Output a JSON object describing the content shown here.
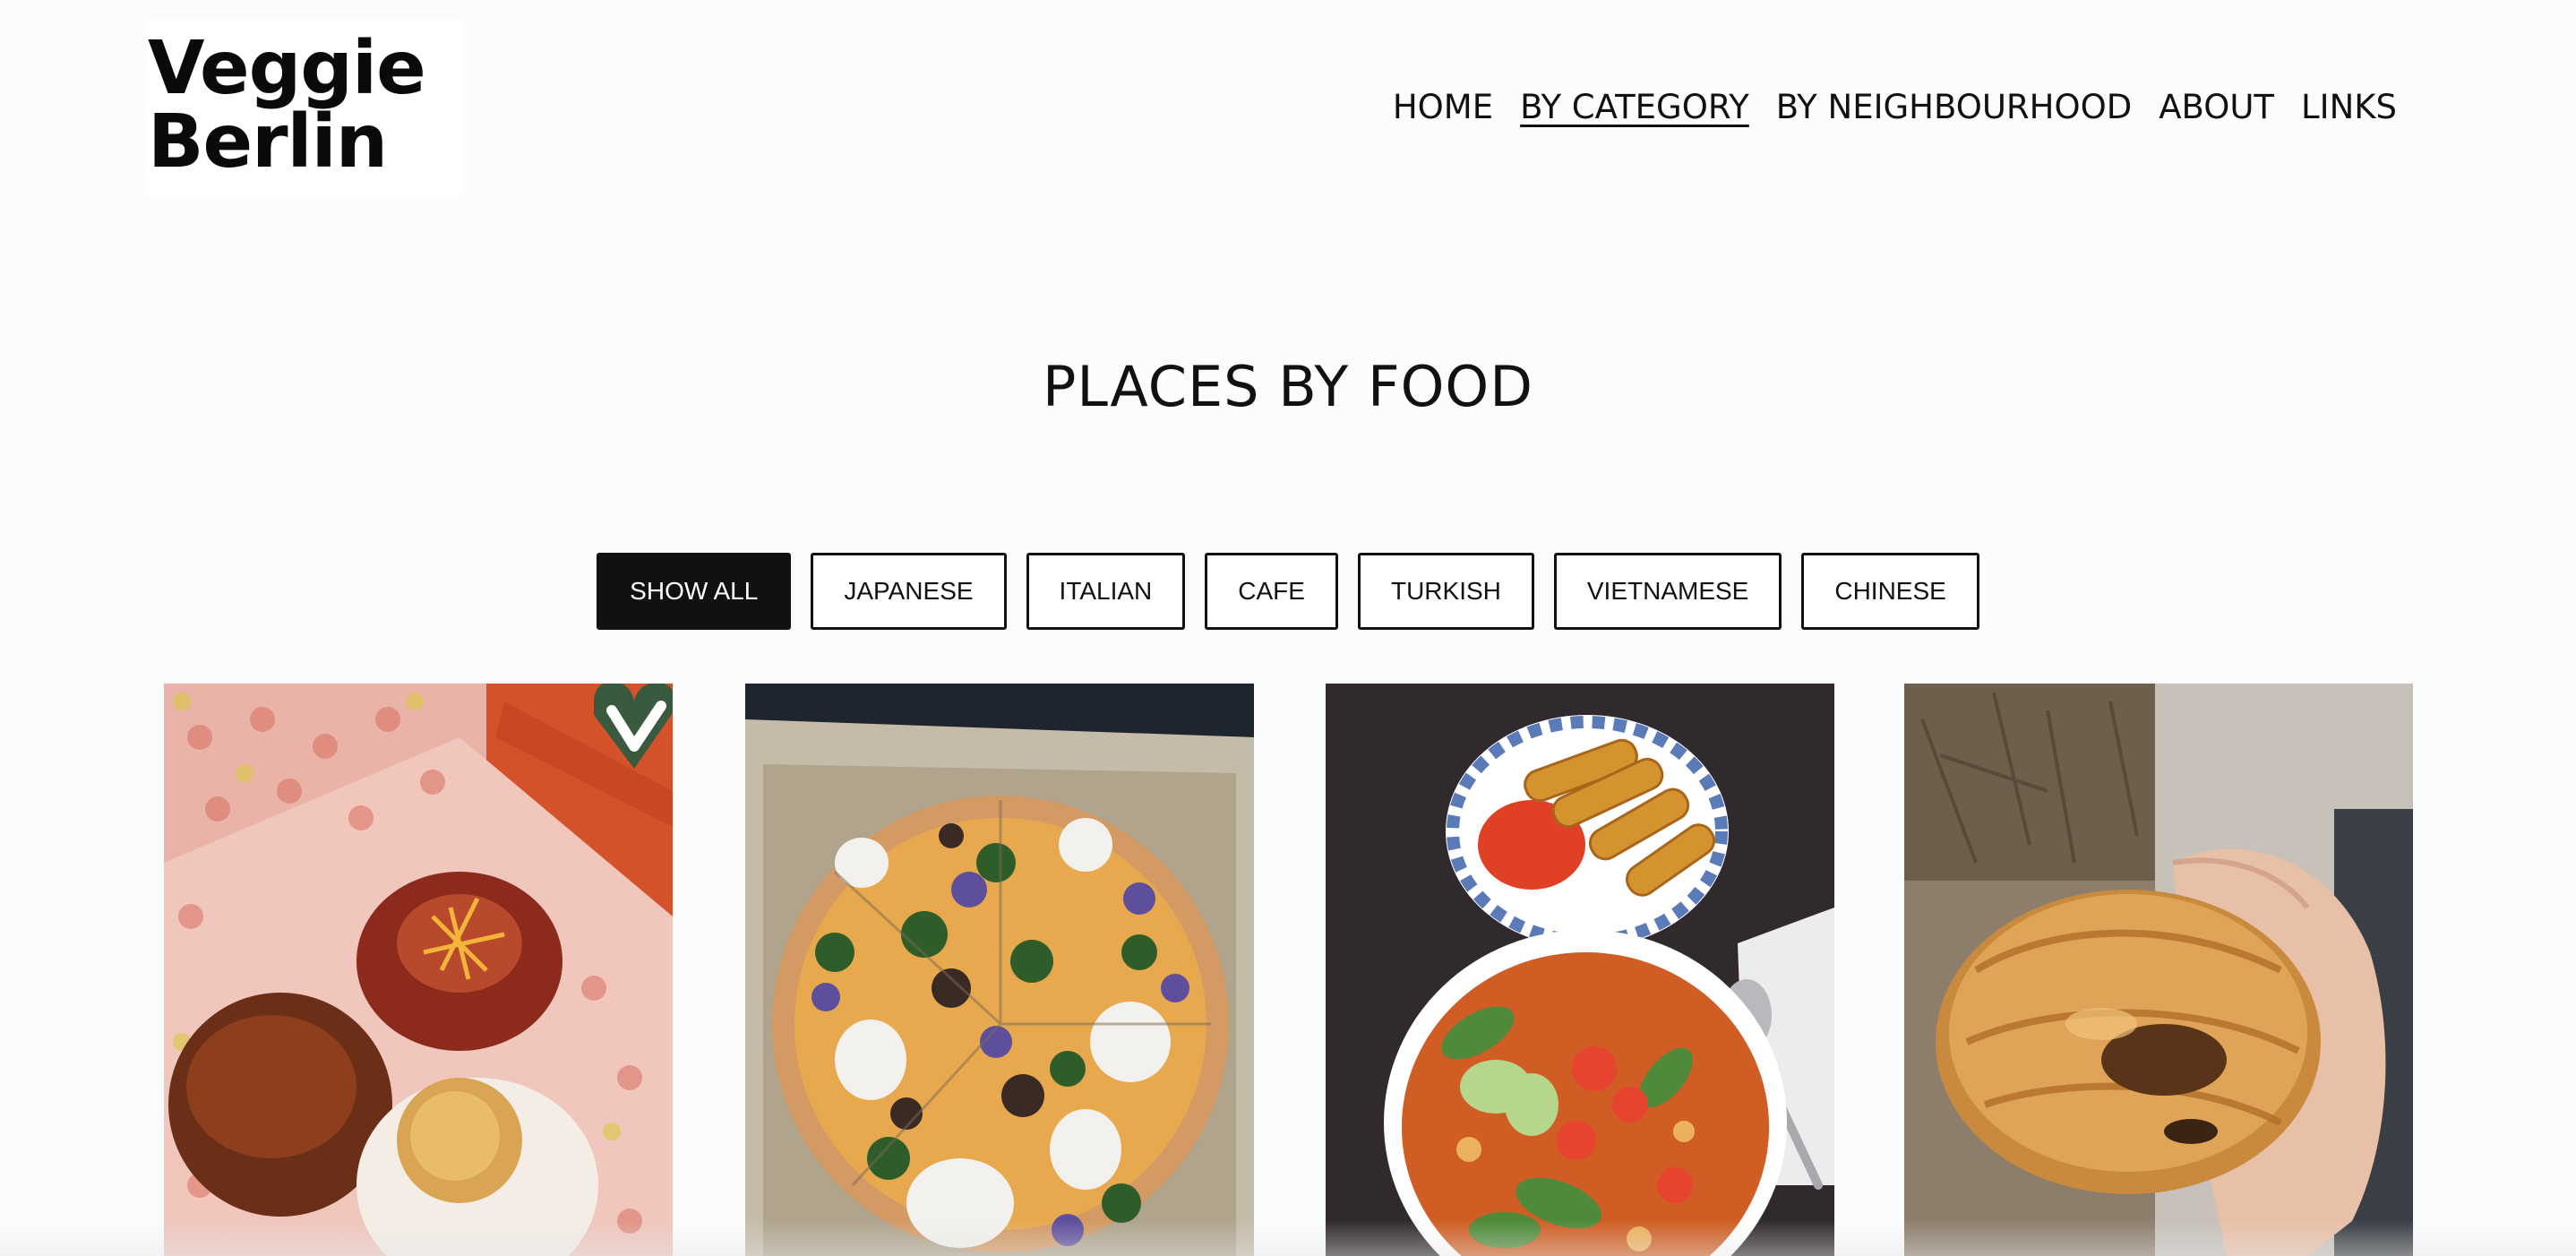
{
  "header": {
    "logo_line1": "Veggie",
    "logo_line2": "Berlin"
  },
  "nav": {
    "items": [
      {
        "label": "HOME",
        "active": false
      },
      {
        "label": "BY CATEGORY",
        "active": true
      },
      {
        "label": "BY NEIGHBOURHOOD",
        "active": false
      },
      {
        "label": "ABOUT",
        "active": false
      },
      {
        "label": "LINKS",
        "active": false
      }
    ]
  },
  "main": {
    "title": "PLACES BY FOOD",
    "filters": [
      {
        "label": "SHOW ALL",
        "active": true
      },
      {
        "label": "JAPANESE",
        "active": false
      },
      {
        "label": "ITALIAN",
        "active": false
      },
      {
        "label": "CAFE",
        "active": false
      },
      {
        "label": "TURKISH",
        "active": false
      },
      {
        "label": "VIETNAMESE",
        "active": false
      },
      {
        "label": "CHINESE",
        "active": false
      }
    ],
    "gallery": [
      {
        "subject": "donuts-in-box-photo",
        "badge": "vegan-heart-icon"
      },
      {
        "subject": "vegetable-pizza-photo"
      },
      {
        "subject": "soup-and-spring-rolls-photo"
      },
      {
        "subject": "croissant-in-hand-photo"
      }
    ]
  },
  "colors": {
    "background": "#fbfcfe",
    "active_filter_bg": "#111111",
    "badge_green": "#3a5a3f"
  }
}
